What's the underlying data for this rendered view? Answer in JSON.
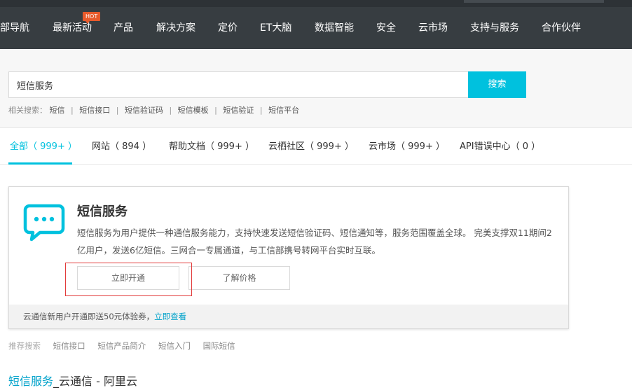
{
  "nav": {
    "items": [
      "部导航",
      "最新活动",
      "产品",
      "解决方案",
      "定价",
      "ET大脑",
      "数据智能",
      "安全",
      "云市场",
      "支持与服务",
      "合作伙伴"
    ],
    "hot_badge": "HOT"
  },
  "search": {
    "value": "短信服务",
    "button_label": "搜索",
    "related_label": "相关搜索：",
    "related": [
      "短信",
      "短信接口",
      "短信验证码",
      "短信模板",
      "短信验证",
      "短信平台"
    ],
    "separator": "|"
  },
  "tabs": [
    {
      "label": "全部（ 999+ ）",
      "active": true
    },
    {
      "label": "网站（ 894 ）",
      "active": false
    },
    {
      "label": "帮助文档（ 999+ ）",
      "active": false
    },
    {
      "label": "云栖社区（ 999+ ）",
      "active": false
    },
    {
      "label": "云市场（ 999+ ）",
      "active": false
    },
    {
      "label": "API错误中心（ 0 ）",
      "active": false
    }
  ],
  "card": {
    "title": "短信服务",
    "description": "短信服务为用户提供一种通信服务能力，支持快速发送短信验证码、短信通知等，服务范围覆盖全球。 完美支撑双11期间2亿用户，发送6亿短信。三网合一专属通道，与工信部携号转网平台实时互联。",
    "icon": "sms-chat-bubble-icon",
    "btn_open": "立即开通",
    "btn_price": "了解价格",
    "footer_text": "云通信新用户开通即送50元体验券，",
    "footer_link": "立即查看"
  },
  "recommend": {
    "label": "推荐搜索",
    "items": [
      "短信接口",
      "短信产品简介",
      "短信入门",
      "国际短信"
    ]
  },
  "result": {
    "title_highlight": "短信服务",
    "title_rest": "_云通信 - 阿里云"
  },
  "colors": {
    "nav_bg": "#373d41",
    "accent": "#00c1de",
    "link": "#00a2ca",
    "hot": "#e85a2b",
    "highlight_border": "#e23b3b"
  }
}
